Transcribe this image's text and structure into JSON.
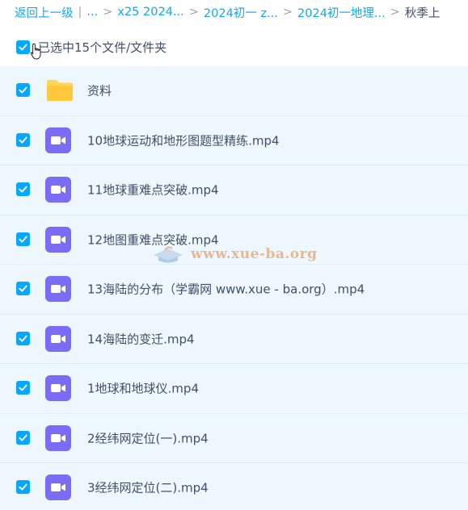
{
  "breadcrumb": {
    "items": [
      "返回上一级",
      "...",
      "x25 2024...",
      "2024初一 z...",
      "2024初一地理...",
      "秋季上"
    ],
    "separators": [
      "|",
      ">",
      ">",
      ">",
      ">"
    ]
  },
  "selection": {
    "text": "已选中15个文件/文件夹",
    "checked": true
  },
  "files": [
    {
      "name": "资料",
      "type": "folder",
      "checked": true
    },
    {
      "name": "10地球运动和地形图题型精练.mp4",
      "type": "video",
      "checked": true
    },
    {
      "name": "11地球重难点突破.mp4",
      "type": "video",
      "checked": true
    },
    {
      "name": "12地图重难点突破.mp4",
      "type": "video",
      "checked": true
    },
    {
      "name": "13海陆的分布（学霸网 www.xue - ba.org）.mp4",
      "type": "video",
      "checked": true
    },
    {
      "name": "14海陆的变迁.mp4",
      "type": "video",
      "checked": true
    },
    {
      "name": "1地球和地球仪.mp4",
      "type": "video",
      "checked": true
    },
    {
      "name": "2经纬网定位(一).mp4",
      "type": "video",
      "checked": true
    },
    {
      "name": "3经纬网定位(二).mp4",
      "type": "video",
      "checked": true
    }
  ],
  "watermark": {
    "text": "www.xue-ba.org"
  },
  "colors": {
    "accent": "#06a7ff",
    "link": "#09aaff",
    "row_selected": "#eef7fe",
    "folder": "#ffd65c",
    "video": "#7b6cf5",
    "text": "#424e67"
  }
}
